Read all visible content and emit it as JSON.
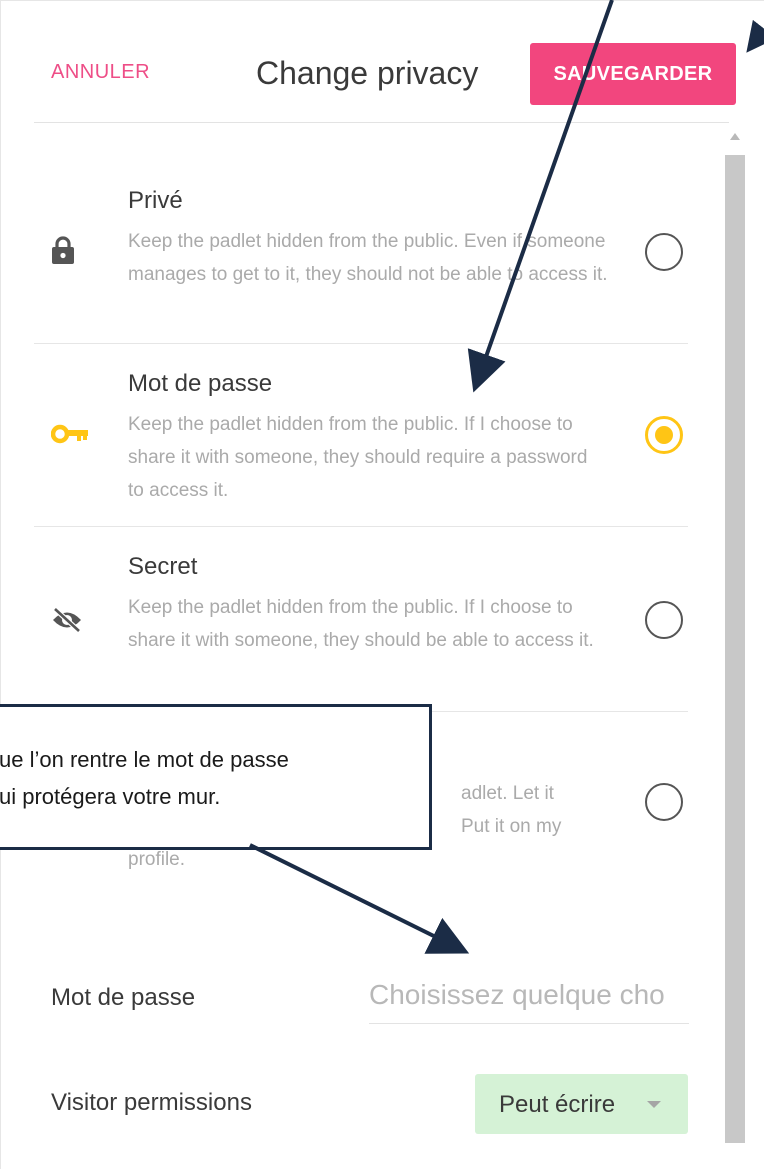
{
  "header": {
    "cancel_label": "ANNULER",
    "title": "Change privacy",
    "save_label": "SAUVEGARDER"
  },
  "options": [
    {
      "title": "Privé",
      "description": "Keep the padlet hidden from the public. Even if someone manages to get to it, they should not be able to access it.",
      "icon": "lock-icon",
      "selected": false
    },
    {
      "title": "Mot de passe",
      "description": "Keep the padlet hidden from the public. If I choose to share it with someone, they should require a password to access it.",
      "icon": "key-icon",
      "selected": true
    },
    {
      "title": "Secret",
      "description": "Keep the padlet hidden from the public. If I choose to share it with someone, they should be able to access it.",
      "icon": "eye-off-icon",
      "selected": false
    },
    {
      "title": "",
      "description_fragments": [
        "adlet. Let it",
        "Put it on my",
        "profile."
      ],
      "icon": "",
      "selected": false
    }
  ],
  "password": {
    "label": "Mot de passe",
    "placeholder": "Choisissez quelque cho"
  },
  "visitor": {
    "label": "Visitor permissions",
    "value": "Peut écrire"
  },
  "callout": {
    "line1": "ue l’on rentre le mot de passe",
    "line2": "ui protégera votre mur."
  },
  "colors": {
    "accent": "#f2467e",
    "selected_radio": "#ffc515",
    "key_icon": "#ffc515",
    "permission_bg": "#d5f2d6",
    "annotation": "#1b2c46"
  }
}
